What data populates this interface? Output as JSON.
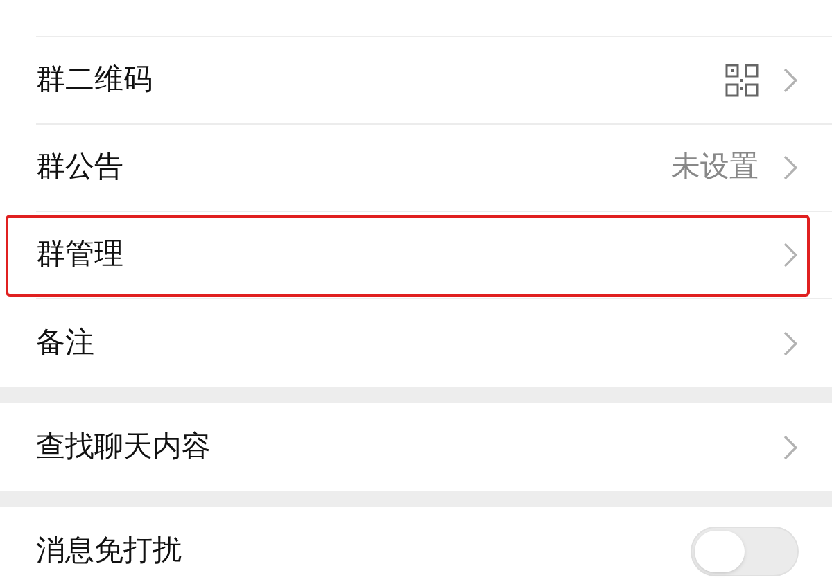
{
  "groups": [
    {
      "rows": [
        {
          "kind": "qrcode",
          "label": "群二维码",
          "highlighted": false
        },
        {
          "kind": "value",
          "label": "群公告",
          "value": "未设置",
          "highlighted": false
        },
        {
          "kind": "link",
          "label": "群管理",
          "highlighted": true
        },
        {
          "kind": "link",
          "label": "备注",
          "highlighted": false
        }
      ]
    },
    {
      "rows": [
        {
          "kind": "link",
          "label": "查找聊天内容",
          "highlighted": false
        }
      ]
    },
    {
      "rows": [
        {
          "kind": "toggle",
          "label": "消息免打扰",
          "on": false,
          "highlighted": false
        }
      ]
    }
  ]
}
